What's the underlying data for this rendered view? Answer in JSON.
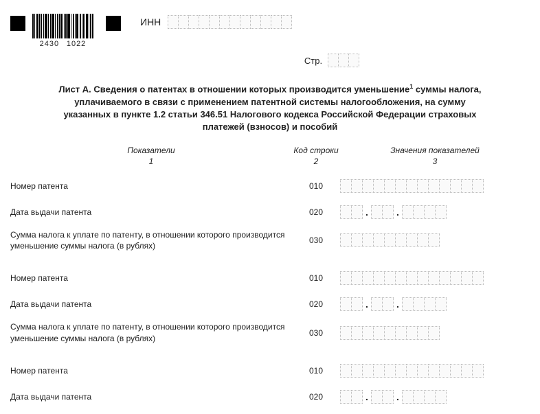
{
  "header": {
    "inn_label": "ИНН",
    "barcode_num_left": "2430",
    "barcode_num_right": "1022",
    "page_label": "Стр."
  },
  "title": {
    "line1_a": "Лист А. Сведения о патентах в отношении которых производится уменьшение",
    "line1_sup": "1",
    "line1_b": " суммы налога,",
    "line2": "уплачиваемого в связи с применением патентной системы налогообложения, на сумму",
    "line3": "указанных в пункте 1.2 статьи 346.51 Налогового кодекса Российской Федерации страховых",
    "line4": "платежей (взносов) и пособий"
  },
  "columns": {
    "indicators": "Показатели",
    "code": "Код строки",
    "values": "Значения показателей",
    "n1": "1",
    "n2": "2",
    "n3": "3"
  },
  "labels": {
    "patent_number": "Номер патента",
    "issue_date": "Дата выдачи патента",
    "tax_sum": "Сумма налога к уплате по патенту, в отношении которого производится уменьшение суммы налога (в рублях)"
  },
  "codes": {
    "c010": "010",
    "c020": "020",
    "c030": "030"
  },
  "date_sep": "."
}
